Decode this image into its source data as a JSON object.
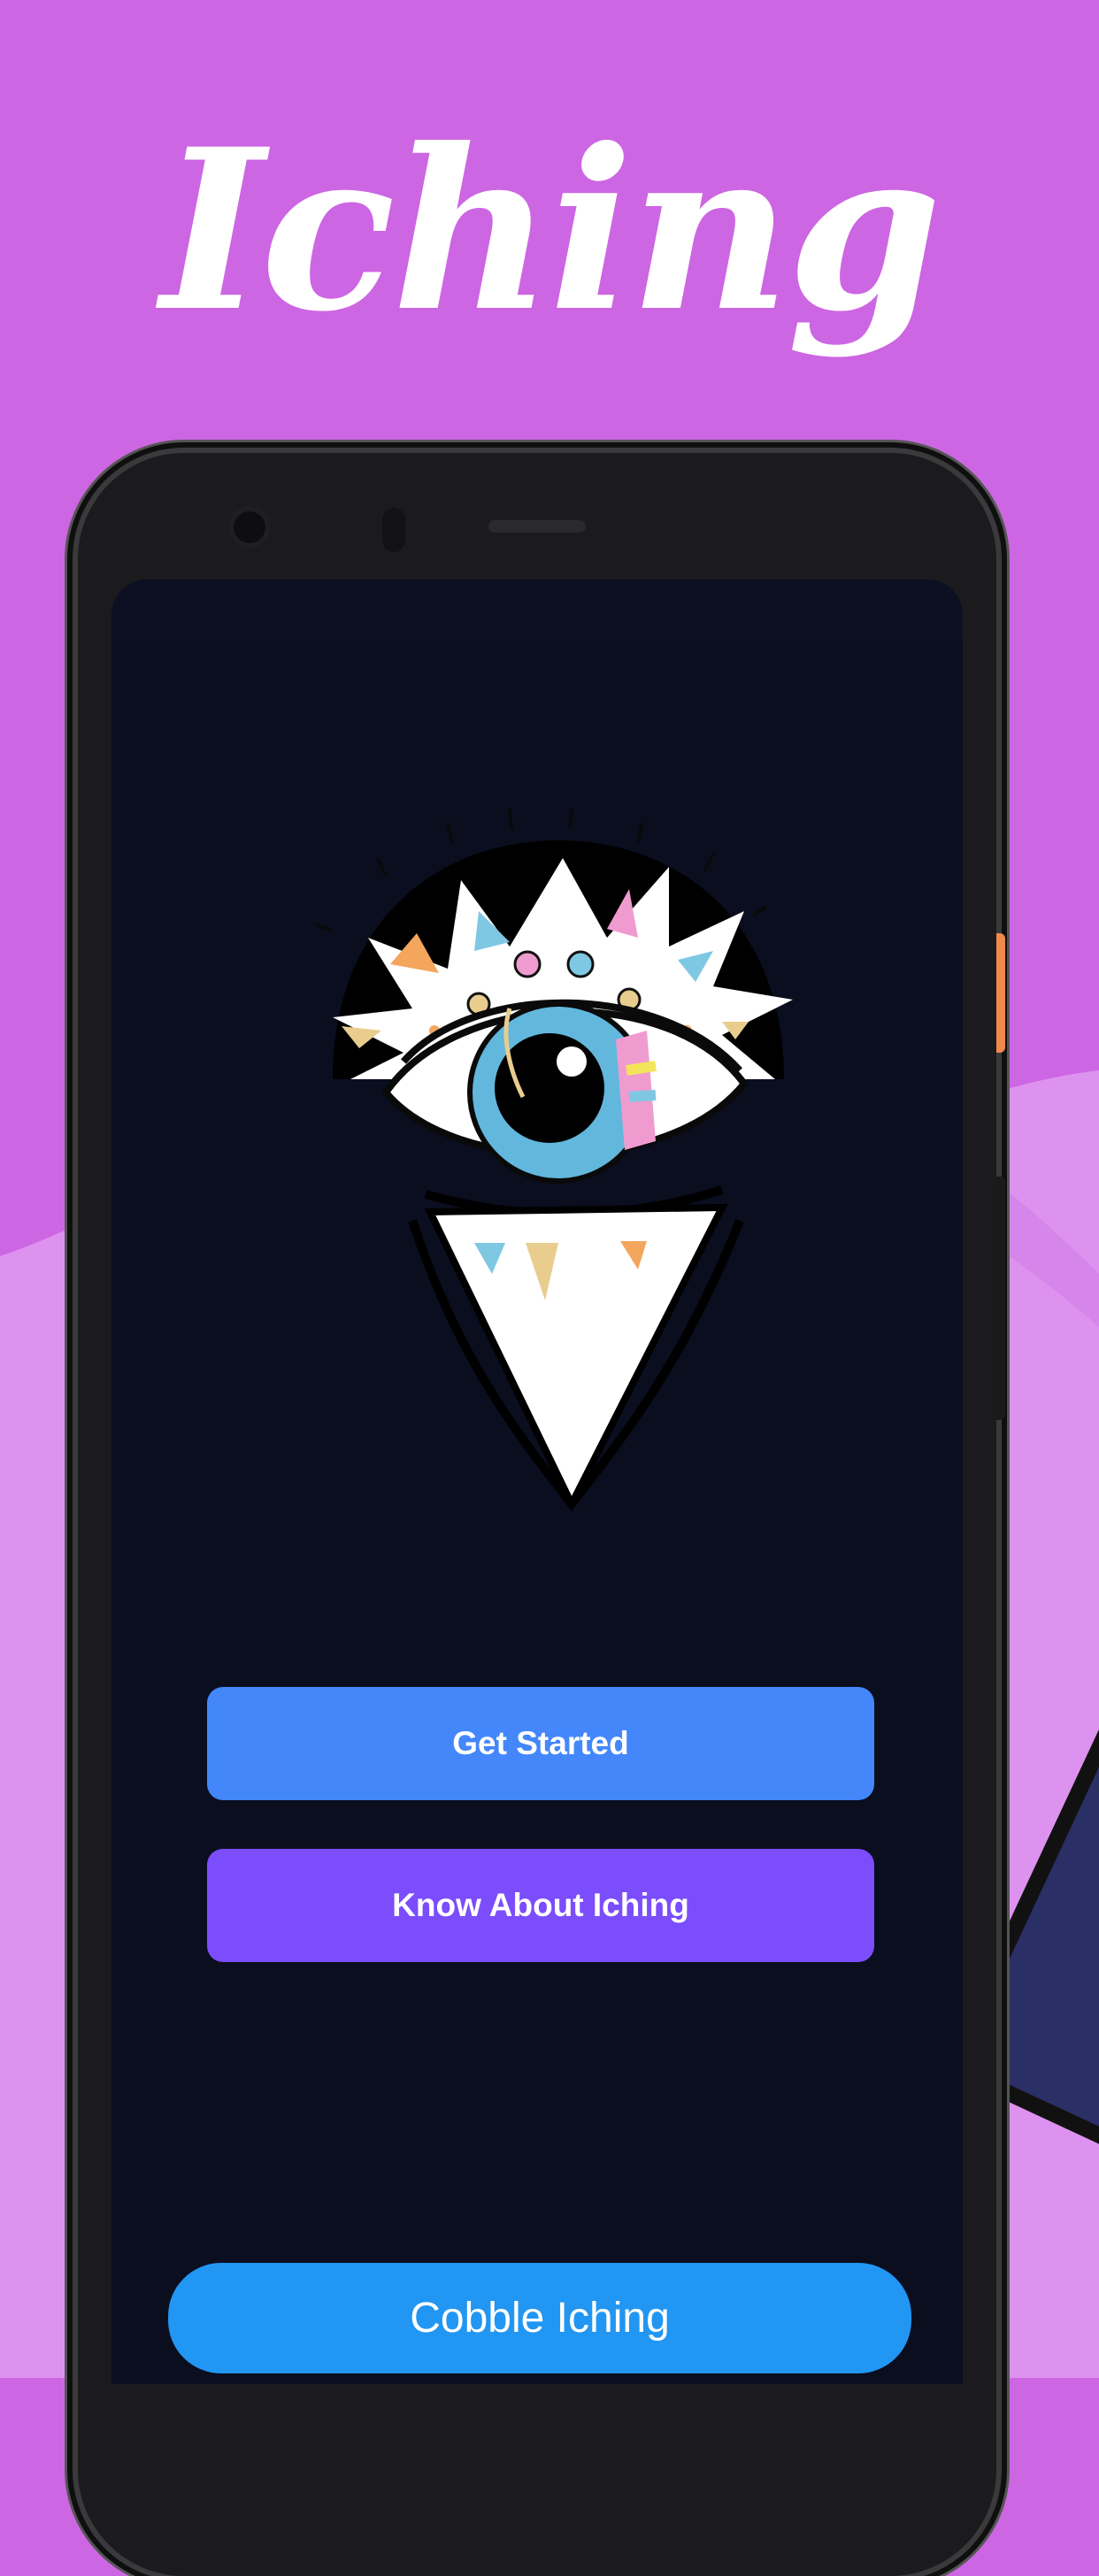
{
  "title": "Iching",
  "screen": {
    "primary_button": "Get Started",
    "secondary_button": "Know About Iching",
    "bottom_button": "Cobble Iching"
  },
  "colors": {
    "background": "#cd66e3",
    "background_lower": "#dd92ef",
    "screen": "#0a0e1f",
    "primary": "#4387fa",
    "secondary": "#7b4dfc",
    "bottom": "#2196f3"
  },
  "icons": [
    "evil-eye-logo-icon"
  ]
}
